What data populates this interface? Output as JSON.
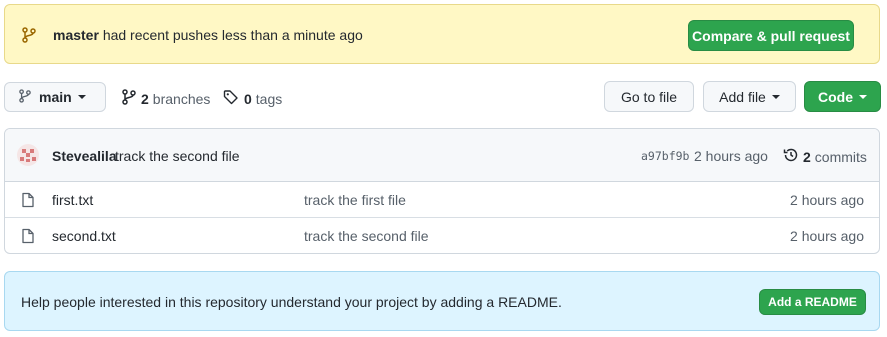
{
  "banner": {
    "branch": "master",
    "message": "had recent pushes less than a minute ago",
    "compare_label": "Compare & pull request"
  },
  "toolbar": {
    "branch_label": "main",
    "branch_count": "2",
    "branches_label": "branches",
    "tag_count": "0",
    "tags_label": "tags",
    "goto_label": "Go to file",
    "addfile_label": "Add file",
    "code_label": "Code"
  },
  "latest_commit": {
    "author": "Stevealila",
    "message": "track the second file",
    "sha": "a97bf9b",
    "time": "2 hours ago",
    "commit_count": "2",
    "commits_label": "commits"
  },
  "files": [
    {
      "name": "first.txt",
      "commit": "track the first file",
      "time": "2 hours ago"
    },
    {
      "name": "second.txt",
      "commit": "track the second file",
      "time": "2 hours ago"
    }
  ],
  "readme": {
    "message": "Help people interested in this repository understand your project by adding a README.",
    "button_label": "Add a README"
  },
  "colors": {
    "accent_green": "#2da44e",
    "banner_bg": "#fff8c5",
    "readme_bg": "#ddf4ff"
  }
}
